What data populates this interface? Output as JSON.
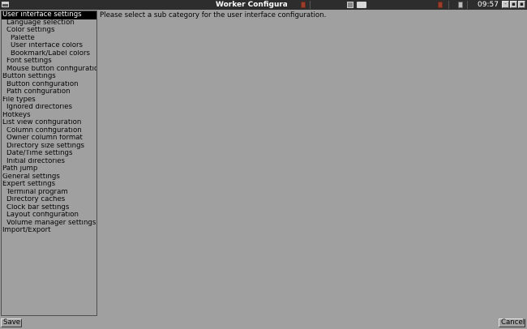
{
  "window": {
    "title": "Worker Configuration",
    "clock": "09:57",
    "controls": {
      "minimize": "-",
      "maximize": "▪",
      "close": "▪"
    }
  },
  "categories": [
    {
      "label": "User interface settings",
      "level": 0,
      "selected": true
    },
    {
      "label": "Language selection",
      "level": 1
    },
    {
      "label": "Color settings",
      "level": 1
    },
    {
      "label": "Palette",
      "level": 2
    },
    {
      "label": "User interface colors",
      "level": 2
    },
    {
      "label": "Bookmark/Label colors",
      "level": 2
    },
    {
      "label": "Font settings",
      "level": 1
    },
    {
      "label": "Mouse button configuration",
      "level": 1
    },
    {
      "label": "Button settings",
      "level": 0
    },
    {
      "label": "Button configuration",
      "level": 1
    },
    {
      "label": "Path configuration",
      "level": 1
    },
    {
      "label": "File types",
      "level": 0
    },
    {
      "label": "Ignored directories",
      "level": 1
    },
    {
      "label": "Hotkeys",
      "level": 0
    },
    {
      "label": "List view configuration",
      "level": 0
    },
    {
      "label": "Column configuration",
      "level": 1
    },
    {
      "label": "Owner column format",
      "level": 1
    },
    {
      "label": "Directory size settings",
      "level": 1
    },
    {
      "label": "Date/Time settings",
      "level": 1
    },
    {
      "label": "Initial directories",
      "level": 1
    },
    {
      "label": "Path jump",
      "level": 0
    },
    {
      "label": "General settings",
      "level": 0
    },
    {
      "label": "Expert settings",
      "level": 0
    },
    {
      "label": "Terminal program",
      "level": 1
    },
    {
      "label": "Directory caches",
      "level": 1
    },
    {
      "label": "Clock bar settings",
      "level": 1
    },
    {
      "label": "Layout configuration",
      "level": 1
    },
    {
      "label": "Volume manager settings",
      "level": 1
    },
    {
      "label": "Import/Export",
      "level": 0
    }
  ],
  "content": {
    "message": "Please select a sub category for the user interface configuration."
  },
  "buttons": {
    "save": "Save",
    "cancel": "Cancel"
  },
  "colors": {
    "background": "#a0a0a0",
    "titlebar": "#2d2d2d",
    "selection": "#000000",
    "selection_text": "#ffffff"
  }
}
